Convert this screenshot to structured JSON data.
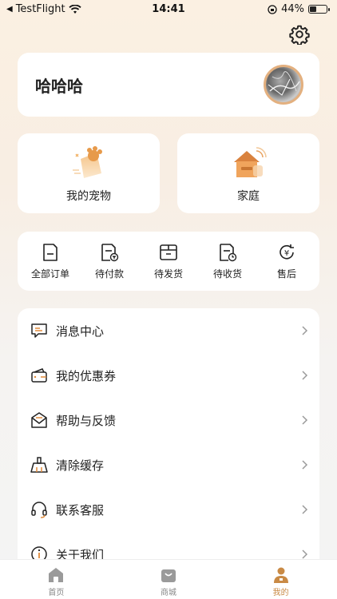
{
  "status": {
    "carrier": "TestFlight",
    "time": "14:41",
    "battery": "44%",
    "battery_level": 0.44
  },
  "profile": {
    "name": "哈哈哈"
  },
  "features": [
    {
      "label": "我的宠物",
      "icon": "pet-paw-icon"
    },
    {
      "label": "家庭",
      "icon": "house-icon"
    }
  ],
  "orders": [
    {
      "label": "全部订单",
      "icon": "all-orders-icon"
    },
    {
      "label": "待付款",
      "icon": "pending-payment-icon"
    },
    {
      "label": "待发货",
      "icon": "pending-shipment-icon"
    },
    {
      "label": "待收货",
      "icon": "pending-receipt-icon"
    },
    {
      "label": "售后",
      "icon": "after-sales-icon"
    }
  ],
  "menu": [
    {
      "label": "消息中心",
      "icon": "message-icon"
    },
    {
      "label": "我的优惠券",
      "icon": "coupon-wallet-icon"
    },
    {
      "label": "帮助与反馈",
      "icon": "mail-feedback-icon"
    },
    {
      "label": "清除缓存",
      "icon": "broom-icon"
    },
    {
      "label": "联系客服",
      "icon": "headset-icon"
    },
    {
      "label": "关于我们",
      "icon": "info-icon"
    }
  ],
  "tabs": [
    {
      "label": "首页",
      "icon": "home-icon",
      "active": false
    },
    {
      "label": "商城",
      "icon": "shop-bag-icon",
      "active": false
    },
    {
      "label": "我的",
      "icon": "profile-icon",
      "active": true
    }
  ],
  "colors": {
    "accent": "#c98a45",
    "avatar_ring": "#e3b07f",
    "background": "#fbf0e2"
  }
}
